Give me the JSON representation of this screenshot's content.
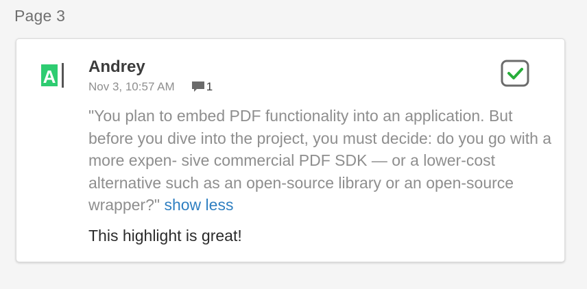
{
  "page_label": "Page 3",
  "highlight": {
    "icon_letter": "A",
    "author": "Andrey",
    "timestamp": "Nov 3, 10:57 AM",
    "comment_count": "1",
    "quote_text": "\"You plan to embed PDF functionality into an application. But before you dive into the project, you must decide: do you go with a more expen- sive commercial PDF SDK — or a lower-cost alternative such as an open-source library or an open-source wrapper?\"",
    "show_less_label": "show less",
    "note": "This highlight is great!"
  },
  "colors": {
    "highlight_green": "#2ecc71",
    "check_green": "#27ae3a",
    "link_blue": "#2f7fc1"
  }
}
